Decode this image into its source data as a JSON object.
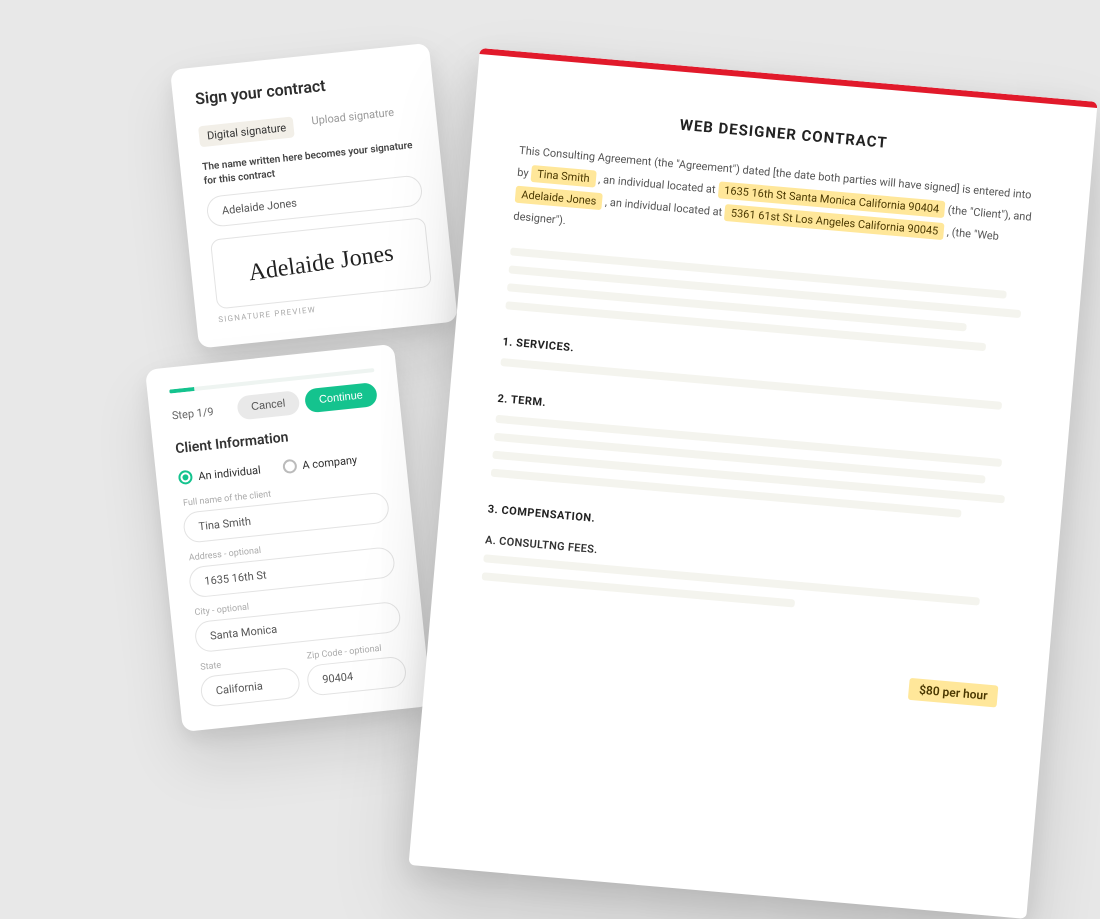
{
  "sign": {
    "title": "Sign your contract",
    "tabs": {
      "digital": "Digital signature",
      "upload": "Upload signature"
    },
    "helper": "The name written here becomes your signature for this contract",
    "name_value": "Adelaide Jones",
    "preview_name": "Adelaide Jones",
    "caption": "SIGNATURE PREVIEW"
  },
  "wizard": {
    "step_label": "Step 1/9",
    "cancel": "Cancel",
    "continue": "Continue",
    "section": "Client Information",
    "opt_individual": "An individual",
    "opt_company": "A company",
    "labels": {
      "fullname": "Full name of the client",
      "address": "Address - optional",
      "city": "City - optional",
      "state": "State",
      "zip": "Zip Code - optional"
    },
    "values": {
      "fullname": "Tina Smith",
      "address": "1635 16th St",
      "city": "Santa Monica",
      "state": "California",
      "zip": "90404"
    }
  },
  "contract": {
    "title": "WEB DESIGNER CONTRACT",
    "para": {
      "p1": "This Consulting Agreement (the \"Agreement\") dated [the date both parties will have signed] is entered into by ",
      "hl_name1": "Tina Smith",
      "p2": " , an individual located at ",
      "hl_addr1": "1635 16th St   Santa Monica   California   90404",
      "p3": " (the \"Client\"), and ",
      "hl_name2": "Adelaide Jones",
      "p4": " , an individual located at ",
      "hl_addr2": "5361 61st St   Los Angeles   California   90045",
      "p5": " , (the \"Web designer\")."
    },
    "sec1": "1. SERVICES.",
    "sec2": "2. TERM.",
    "sec3": "3. COMPENSATION.",
    "sec3a": "A. CONSULTNG FEES.",
    "rate": "$80 per hour"
  }
}
